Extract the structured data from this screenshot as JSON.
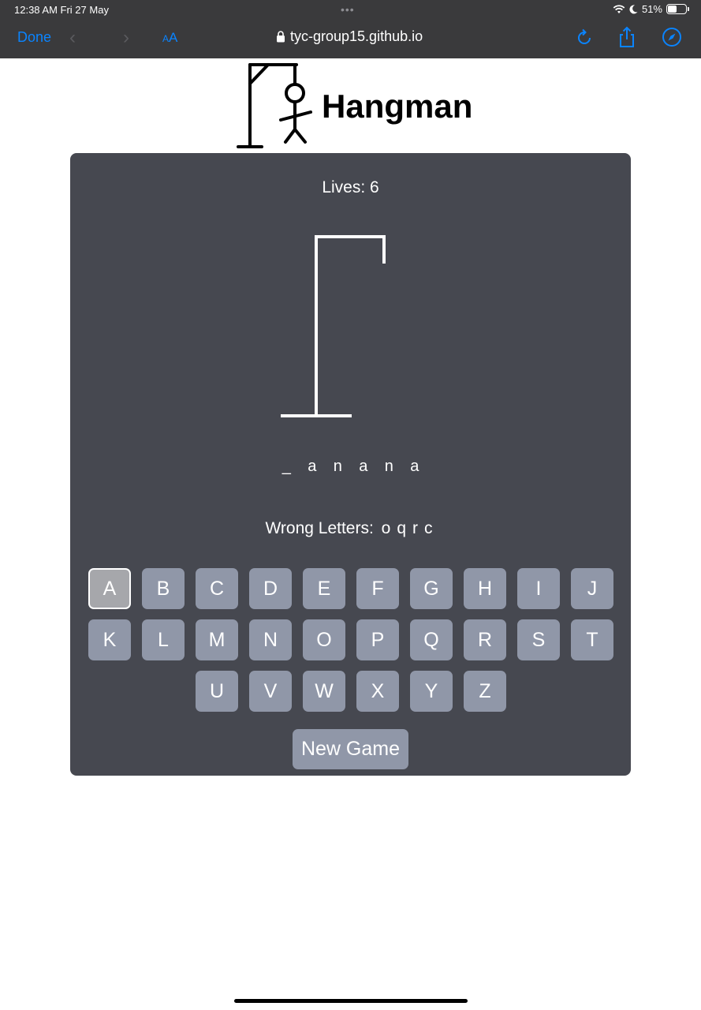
{
  "status": {
    "time": "12:38 AM  Fri 27 May",
    "battery": "51%",
    "battery_level": 0.51
  },
  "browser": {
    "done_label": "Done",
    "aa_label": "AA",
    "url": "tyc-group15.github.io"
  },
  "header": {
    "title": "Hangman"
  },
  "game": {
    "lives_label": "Lives: 6",
    "word": [
      "_",
      "a",
      "n",
      "a",
      "n",
      "a"
    ],
    "wrong_label": "Wrong Letters:",
    "wrong_letters": [
      "o",
      "q",
      "r",
      "c"
    ],
    "keyboard": [
      [
        "A",
        "B",
        "C",
        "D",
        "E",
        "F",
        "G",
        "H",
        "I",
        "J"
      ],
      [
        "K",
        "L",
        "M",
        "N",
        "O",
        "P",
        "Q",
        "R",
        "S",
        "T"
      ],
      [
        "U",
        "V",
        "W",
        "X",
        "Y",
        "Z"
      ]
    ],
    "used_keys": [
      "A"
    ],
    "new_game_label": "New Game"
  },
  "colors": {
    "card": "#464850",
    "key": "#9097a8",
    "accent": "#0a84ff"
  }
}
